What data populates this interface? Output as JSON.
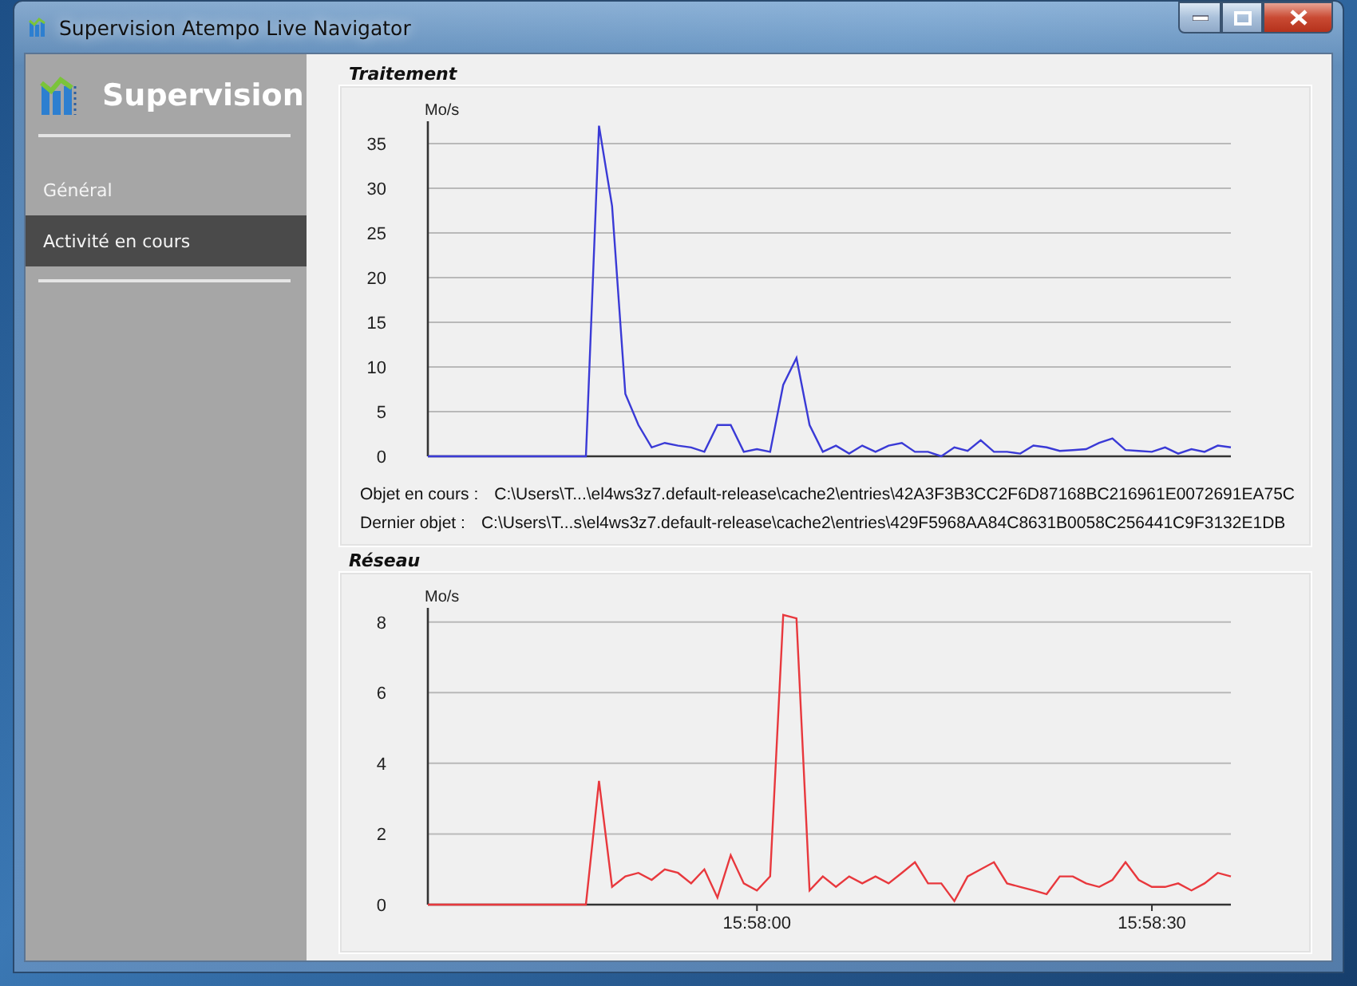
{
  "window": {
    "title": "Supervision Atempo Live Navigator"
  },
  "sidebar": {
    "title": "Supervision",
    "items": [
      {
        "label": "Général",
        "selected": false
      },
      {
        "label": "Activité en cours",
        "selected": true
      }
    ]
  },
  "panels": [
    {
      "title": "Traitement",
      "chart_data": {
        "type": "line",
        "ylabel": "Mo/s",
        "categories": [
          null,
          null,
          null,
          null,
          null,
          null,
          null,
          null,
          null,
          null,
          null,
          null,
          null,
          null,
          null,
          null,
          null,
          null,
          null,
          null,
          null,
          null,
          null,
          null,
          null,
          null,
          null,
          null,
          null,
          null,
          null,
          null,
          null,
          null,
          null,
          null,
          null,
          null,
          null,
          null,
          null,
          null,
          null,
          null,
          null,
          null,
          null,
          null,
          null,
          null,
          null,
          null,
          null,
          null,
          null,
          null,
          null,
          null,
          null,
          null,
          null,
          null
        ],
        "ylim": [
          0,
          37.5
        ],
        "grid": true,
        "yticks": [
          0,
          5,
          10,
          15,
          20,
          25,
          30,
          35
        ],
        "series": [
          {
            "color": "#3a3ad6",
            "values": [
              0,
              0,
              0,
              0,
              0,
              0,
              0,
              0,
              0,
              0,
              0,
              0,
              0,
              37,
              28,
              7,
              3.5,
              1,
              1.5,
              1.2,
              1,
              0.5,
              3.5,
              3.5,
              0.5,
              0.8,
              0.5,
              8,
              11,
              3.5,
              0.5,
              1.2,
              0.3,
              1.2,
              0.5,
              1.2,
              1.5,
              0.5,
              0.5,
              0,
              1,
              0.6,
              1.8,
              0.5,
              0.5,
              0.3,
              1.2,
              1,
              0.6,
              0.7,
              0.8,
              1.5,
              2,
              0.7,
              0.6,
              0.5,
              1,
              0.3,
              0.8,
              0.5,
              1.2,
              1
            ]
          }
        ]
      },
      "details": [
        {
          "label": "Objet en cours :",
          "value": "C:\\Users\\T...\\el4ws3z7.default-release\\cache2\\entries\\42A3F3B3CC2F6D87168BC216961E0072691EA75C"
        },
        {
          "label": "Dernier objet :",
          "value": "C:\\Users\\T...s\\el4ws3z7.default-release\\cache2\\entries\\429F5968AA84C8631B0058C256441C9F3132E1DB"
        }
      ]
    },
    {
      "title": "Réseau",
      "chart_data": {
        "type": "line",
        "ylabel": "Mo/s",
        "categories": [
          null,
          null,
          null,
          null,
          null,
          null,
          null,
          null,
          null,
          null,
          null,
          null,
          null,
          null,
          null,
          null,
          null,
          null,
          null,
          null,
          null,
          null,
          null,
          null,
          null,
          "15:58:00",
          null,
          null,
          null,
          null,
          null,
          null,
          null,
          null,
          null,
          null,
          null,
          null,
          null,
          null,
          null,
          null,
          null,
          null,
          null,
          null,
          null,
          null,
          null,
          null,
          null,
          null,
          null,
          null,
          null,
          "15:58:30",
          null,
          null,
          null,
          null,
          null,
          null
        ],
        "ylim": [
          0,
          8.4
        ],
        "grid": true,
        "yticks": [
          0,
          2,
          4,
          6,
          8
        ],
        "series": [
          {
            "color": "#e8383d",
            "values": [
              0,
              0,
              0,
              0,
              0,
              0,
              0,
              0,
              0,
              0,
              0,
              0,
              0,
              3.5,
              0.5,
              0.8,
              0.9,
              0.7,
              1,
              0.9,
              0.6,
              1,
              0.2,
              1.4,
              0.6,
              0.4,
              0.8,
              8.2,
              8.1,
              0.4,
              0.8,
              0.5,
              0.8,
              0.6,
              0.8,
              0.6,
              0.9,
              1.2,
              0.6,
              0.6,
              0.1,
              0.8,
              1,
              1.2,
              0.6,
              0.5,
              0.4,
              0.3,
              0.8,
              0.8,
              0.6,
              0.5,
              0.7,
              1.2,
              0.7,
              0.5,
              0.5,
              0.6,
              0.4,
              0.6,
              0.9,
              0.8
            ]
          }
        ]
      }
    }
  ]
}
